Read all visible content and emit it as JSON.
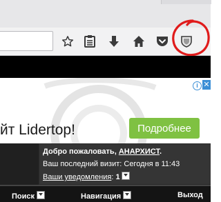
{
  "browser": {
    "toolbar_icons": [
      "star-icon",
      "reading-list-icon",
      "download-icon",
      "home-icon",
      "pocket-icon",
      "shield-extension-icon"
    ]
  },
  "annotation_color": "#e01b1b",
  "ad": {
    "text": "йт Lidertop!",
    "button_label": "Подробнее",
    "button_color": "#7fc142",
    "info_label": "i",
    "close_label": "✕"
  },
  "forum": {
    "welcome_prefix": "Добро пожаловать, ",
    "username": "АНАРХИСТ",
    "welcome_suffix": ".",
    "last_visit": "Ваш последний визит: Сегодня в 11:43",
    "notifications_label": "Ваши уведомления",
    "notifications_sep": ": ",
    "notifications_count": "1"
  },
  "nav": {
    "search": "Поиск",
    "navigation": "Навигация",
    "logout": "Выход"
  }
}
